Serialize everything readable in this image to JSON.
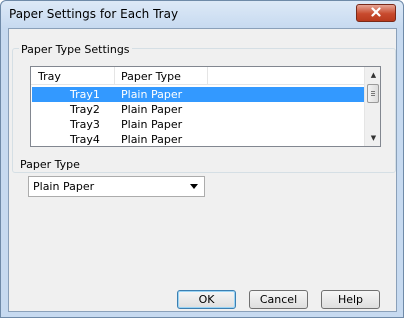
{
  "window": {
    "title": "Paper Settings for Each Tray"
  },
  "group": {
    "label": "Paper Type Settings"
  },
  "list": {
    "columns": [
      "Tray",
      "Paper Type"
    ],
    "rows": [
      {
        "tray": "Tray1",
        "paper_type": "Plain Paper",
        "selected": true
      },
      {
        "tray": "Tray2",
        "paper_type": "Plain Paper",
        "selected": false
      },
      {
        "tray": "Tray3",
        "paper_type": "Plain Paper",
        "selected": false
      },
      {
        "tray": "Tray4",
        "paper_type": "Plain Paper",
        "selected": false
      }
    ]
  },
  "paper_type": {
    "label": "Paper Type",
    "value": "Plain Paper"
  },
  "buttons": {
    "ok": "OK",
    "cancel": "Cancel",
    "help": "Help"
  },
  "icons": {
    "close": "close-icon",
    "scroll_up": "scroll-up-icon",
    "scroll_down": "scroll-down-icon",
    "dropdown": "chevron-down-icon"
  },
  "colors": {
    "selection": "#3399ff",
    "title_bar": "#c7daf0",
    "close_button": "#c84a2d"
  }
}
